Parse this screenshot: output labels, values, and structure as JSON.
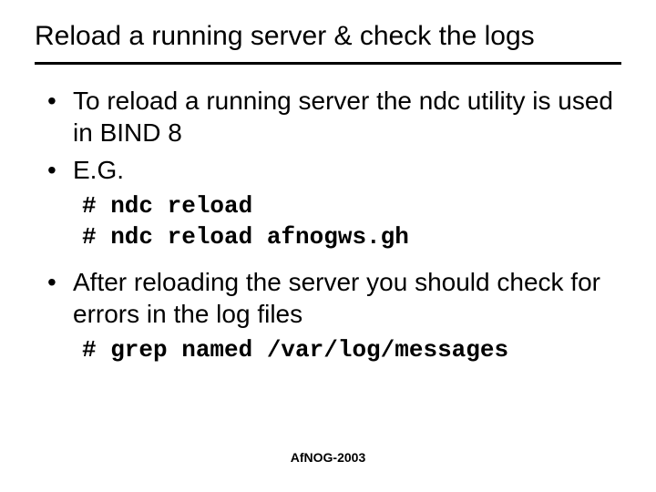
{
  "slide": {
    "title": "Reload a running server & check the logs",
    "bullets": {
      "b1": "To reload a running server the ndc utility is used in BIND 8",
      "b2": "E.G.",
      "b3": "After reloading the server you should check for errors in the log files"
    },
    "code": {
      "block1_line1": "# ndc reload",
      "block1_line2": "# ndc reload afnogws.gh",
      "block2_line1": "# grep named /var/log/messages"
    },
    "footer": "AfNOG-2003"
  }
}
